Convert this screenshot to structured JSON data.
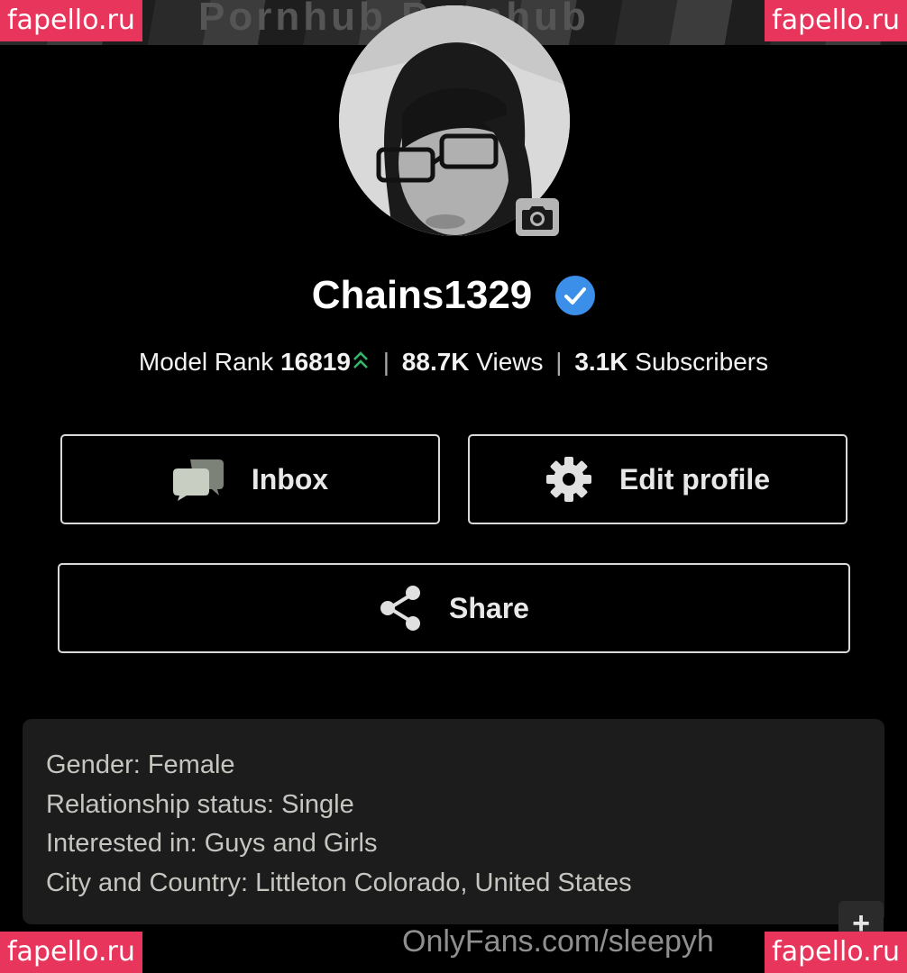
{
  "cover": {
    "background_text": "Pornhub Pornhub"
  },
  "watermarks": {
    "top_left": "fapello.ru",
    "top_right": "fapello.ru",
    "bottom_left": "fapello.ru",
    "bottom_right": "fapello.ru",
    "footer": "OnlyFans.com/sleepyh"
  },
  "profile": {
    "username": "Chains1329",
    "verified": true,
    "verified_color": "#3b8fe8"
  },
  "stats": {
    "rank_label": "Model Rank",
    "rank_value": "16819",
    "rank_trend_icon": "double-chevron-up-icon",
    "rank_trend_color": "#31b86b",
    "separator": "|",
    "views_value": "88.7K",
    "views_label": "Views",
    "subscribers_value": "3.1K",
    "subscribers_label": "Subscribers"
  },
  "actions": {
    "inbox_label": "Inbox",
    "edit_profile_label": "Edit profile",
    "share_label": "Share"
  },
  "about": {
    "lines": [
      "Gender: Female",
      "Relationship status: Single",
      "Interested in: Guys and Girls",
      "City and Country: Littleton Colorado, United States"
    ],
    "expand_symbol": "+"
  },
  "colors": {
    "background": "#000000",
    "button_border": "#d9d9d9",
    "info_panel": "#1c1c1c",
    "watermark": "#e8355b"
  }
}
